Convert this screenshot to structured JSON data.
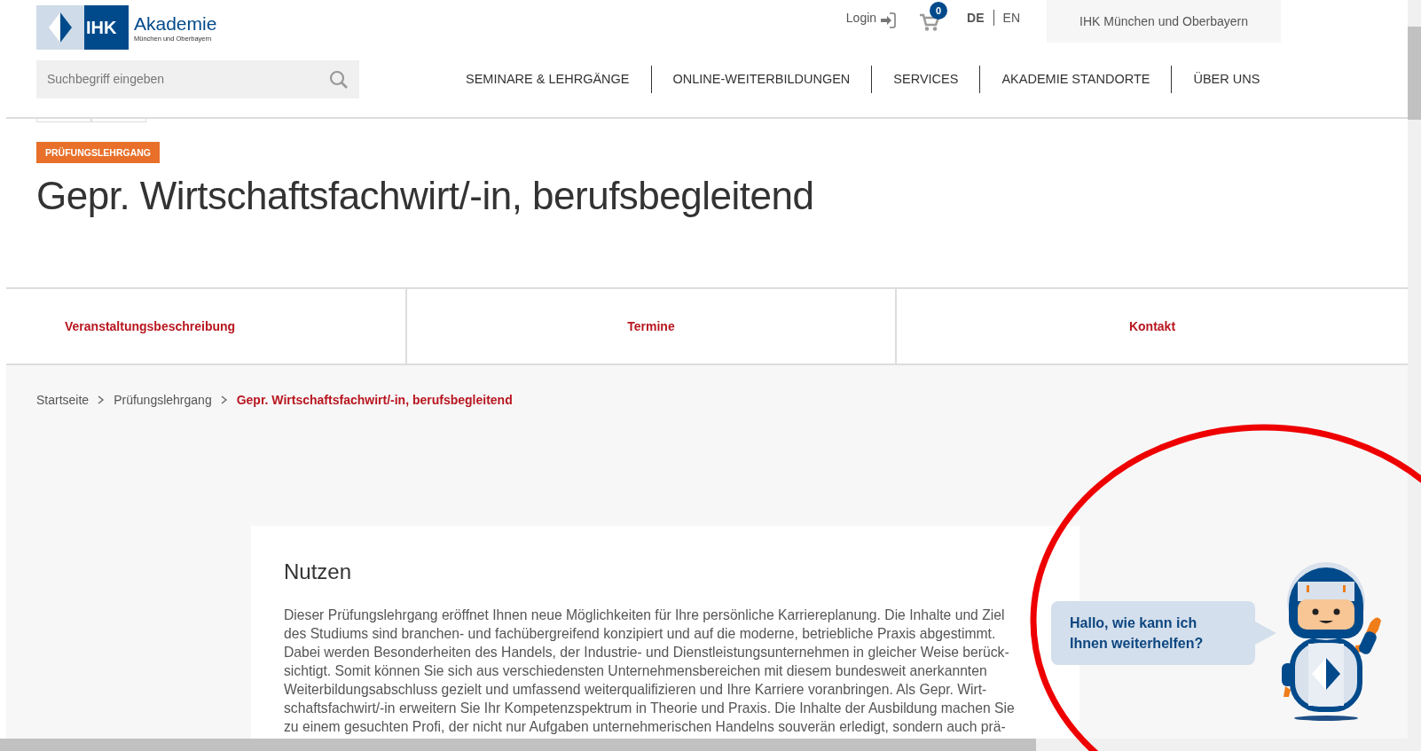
{
  "logo": {
    "mark": "IHK",
    "name": "Akademie",
    "subtitle": "München und Oberbayern"
  },
  "top_bar": {
    "login": "Login",
    "cart_count": "0",
    "languages": [
      {
        "label": "DE",
        "selected": true
      },
      {
        "label": "EN",
        "selected": false
      }
    ],
    "region_button": "IHK München und Oberbayern"
  },
  "search": {
    "placeholder": "Suchbegriff eingeben"
  },
  "nav": [
    "SEMINARE & LEHRGÄNGE",
    "ONLINE-WEITERBILDUNGEN",
    "SERVICES",
    "AKADEMIE STANDORTE",
    "ÜBER UNS"
  ],
  "badge": "PRÜFUNGSLEHRGANG",
  "title": "Gepr. Wirtschaftsfachwirt/-in, berufsbegleitend",
  "tabs": [
    "Veranstaltungsbeschreibung",
    "Termine",
    "Kontakt"
  ],
  "breadcrumb": [
    {
      "label": "Startseite",
      "current": false
    },
    {
      "label": "Prüfungslehrgang",
      "current": false
    },
    {
      "label": "Gepr. Wirtschaftsfachwirt/-in, berufsbegleitend",
      "current": true
    }
  ],
  "section": {
    "heading": "Nutzen",
    "lines": [
      "Dieser Prüfungslehrgang eröffnet Ihnen neue Möglichkeiten für Ihre persönliche Karriereplanung. Die Inhalte und Ziel",
      "des Studiums sind branchen- und fachübergreifend konzipiert und auf die moderne, betriebliche Praxis abgestimmt.",
      "Dabei werden Besonderheiten des Handels, der Industrie- und Dienstleistungsunternehmen in gleicher Weise berück-",
      "sichtigt. Somit können Sie sich aus verschiedensten Unternehmensbereichen mit diesem bundesweit anerkannten",
      "Weiterbildungsabschluss gezielt und umfassend weiterqualifizieren und Ihre Karriere voranbringen. Als Gepr. Wirt-",
      "schaftsfachwirt/-in erweitern Sie Ihr Kompetenzspektrum in Theorie und Praxis. Die Inhalte der Ausbildung machen Sie",
      "zu einem gesuchten Profi, der nicht nur Aufgaben unternehmerischen Handelns souverän erledigt, sondern auch prä-"
    ]
  },
  "chat": {
    "greeting_lines": [
      "Hallo, wie kann ich",
      "Ihnen weiterhelfen?"
    ]
  }
}
